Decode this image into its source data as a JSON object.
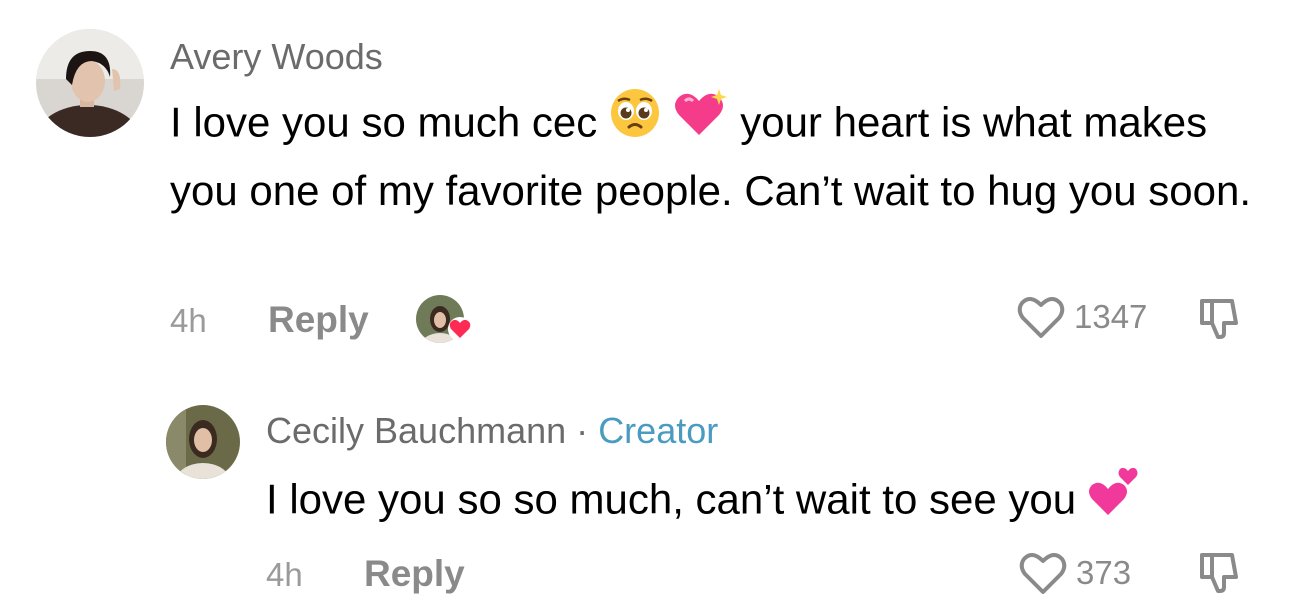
{
  "comments": [
    {
      "author": "Avery Woods",
      "text_before": "I love you so much cec ",
      "text_after": " your heart is what makes you one of my favorite people. Can’t wait to hug you soon.",
      "emoji": [
        "pleading-face-emoji",
        "sparkling-heart-emoji"
      ],
      "time": "4h",
      "reply_label": "Reply",
      "likes": "1347",
      "creator_liked": true
    },
    {
      "author": "Cecily Bauchmann",
      "separator": "·",
      "badge": "Creator",
      "text": "I love you so so much, can’t wait to see you ",
      "emoji": [
        "two-hearts-emoji"
      ],
      "time": "4h",
      "reply_label": "Reply",
      "likes": "373"
    }
  ],
  "colors": {
    "badge": "#4a9bc1",
    "liked_heart": "#fe2c55",
    "meta": "#8a8a8a"
  }
}
